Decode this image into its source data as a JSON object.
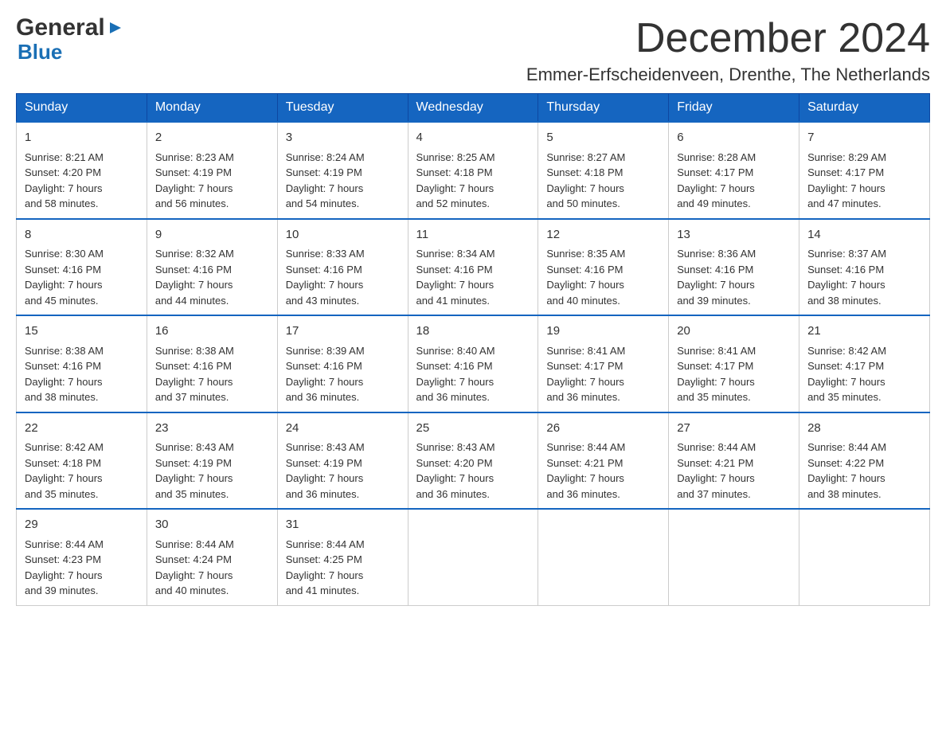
{
  "header": {
    "logo_general": "General",
    "logo_blue": "Blue",
    "month_title": "December 2024",
    "location": "Emmer-Erfscheidenveen, Drenthe, The Netherlands"
  },
  "days_of_week": [
    "Sunday",
    "Monday",
    "Tuesday",
    "Wednesday",
    "Thursday",
    "Friday",
    "Saturday"
  ],
  "weeks": [
    [
      {
        "day": "1",
        "sunrise": "8:21 AM",
        "sunset": "4:20 PM",
        "daylight": "7 hours and 58 minutes."
      },
      {
        "day": "2",
        "sunrise": "8:23 AM",
        "sunset": "4:19 PM",
        "daylight": "7 hours and 56 minutes."
      },
      {
        "day": "3",
        "sunrise": "8:24 AM",
        "sunset": "4:19 PM",
        "daylight": "7 hours and 54 minutes."
      },
      {
        "day": "4",
        "sunrise": "8:25 AM",
        "sunset": "4:18 PM",
        "daylight": "7 hours and 52 minutes."
      },
      {
        "day": "5",
        "sunrise": "8:27 AM",
        "sunset": "4:18 PM",
        "daylight": "7 hours and 50 minutes."
      },
      {
        "day": "6",
        "sunrise": "8:28 AM",
        "sunset": "4:17 PM",
        "daylight": "7 hours and 49 minutes."
      },
      {
        "day": "7",
        "sunrise": "8:29 AM",
        "sunset": "4:17 PM",
        "daylight": "7 hours and 47 minutes."
      }
    ],
    [
      {
        "day": "8",
        "sunrise": "8:30 AM",
        "sunset": "4:16 PM",
        "daylight": "7 hours and 45 minutes."
      },
      {
        "day": "9",
        "sunrise": "8:32 AM",
        "sunset": "4:16 PM",
        "daylight": "7 hours and 44 minutes."
      },
      {
        "day": "10",
        "sunrise": "8:33 AM",
        "sunset": "4:16 PM",
        "daylight": "7 hours and 43 minutes."
      },
      {
        "day": "11",
        "sunrise": "8:34 AM",
        "sunset": "4:16 PM",
        "daylight": "7 hours and 41 minutes."
      },
      {
        "day": "12",
        "sunrise": "8:35 AM",
        "sunset": "4:16 PM",
        "daylight": "7 hours and 40 minutes."
      },
      {
        "day": "13",
        "sunrise": "8:36 AM",
        "sunset": "4:16 PM",
        "daylight": "7 hours and 39 minutes."
      },
      {
        "day": "14",
        "sunrise": "8:37 AM",
        "sunset": "4:16 PM",
        "daylight": "7 hours and 38 minutes."
      }
    ],
    [
      {
        "day": "15",
        "sunrise": "8:38 AM",
        "sunset": "4:16 PM",
        "daylight": "7 hours and 38 minutes."
      },
      {
        "day": "16",
        "sunrise": "8:38 AM",
        "sunset": "4:16 PM",
        "daylight": "7 hours and 37 minutes."
      },
      {
        "day": "17",
        "sunrise": "8:39 AM",
        "sunset": "4:16 PM",
        "daylight": "7 hours and 36 minutes."
      },
      {
        "day": "18",
        "sunrise": "8:40 AM",
        "sunset": "4:16 PM",
        "daylight": "7 hours and 36 minutes."
      },
      {
        "day": "19",
        "sunrise": "8:41 AM",
        "sunset": "4:17 PM",
        "daylight": "7 hours and 36 minutes."
      },
      {
        "day": "20",
        "sunrise": "8:41 AM",
        "sunset": "4:17 PM",
        "daylight": "7 hours and 35 minutes."
      },
      {
        "day": "21",
        "sunrise": "8:42 AM",
        "sunset": "4:17 PM",
        "daylight": "7 hours and 35 minutes."
      }
    ],
    [
      {
        "day": "22",
        "sunrise": "8:42 AM",
        "sunset": "4:18 PM",
        "daylight": "7 hours and 35 minutes."
      },
      {
        "day": "23",
        "sunrise": "8:43 AM",
        "sunset": "4:19 PM",
        "daylight": "7 hours and 35 minutes."
      },
      {
        "day": "24",
        "sunrise": "8:43 AM",
        "sunset": "4:19 PM",
        "daylight": "7 hours and 36 minutes."
      },
      {
        "day": "25",
        "sunrise": "8:43 AM",
        "sunset": "4:20 PM",
        "daylight": "7 hours and 36 minutes."
      },
      {
        "day": "26",
        "sunrise": "8:44 AM",
        "sunset": "4:21 PM",
        "daylight": "7 hours and 36 minutes."
      },
      {
        "day": "27",
        "sunrise": "8:44 AM",
        "sunset": "4:21 PM",
        "daylight": "7 hours and 37 minutes."
      },
      {
        "day": "28",
        "sunrise": "8:44 AM",
        "sunset": "4:22 PM",
        "daylight": "7 hours and 38 minutes."
      }
    ],
    [
      {
        "day": "29",
        "sunrise": "8:44 AM",
        "sunset": "4:23 PM",
        "daylight": "7 hours and 39 minutes."
      },
      {
        "day": "30",
        "sunrise": "8:44 AM",
        "sunset": "4:24 PM",
        "daylight": "7 hours and 40 minutes."
      },
      {
        "day": "31",
        "sunrise": "8:44 AM",
        "sunset": "4:25 PM",
        "daylight": "7 hours and 41 minutes."
      },
      null,
      null,
      null,
      null
    ]
  ],
  "labels": {
    "sunrise": "Sunrise:",
    "sunset": "Sunset:",
    "daylight": "Daylight:"
  }
}
